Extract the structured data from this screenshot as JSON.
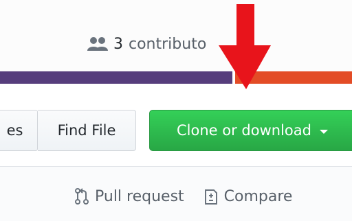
{
  "contributors": {
    "icon": "people-icon",
    "count": "3",
    "label": "contributo"
  },
  "language_bar": {
    "colors": [
      "#563d7c",
      "#e34c26"
    ]
  },
  "toolbar": {
    "prev_label": "es",
    "find_file_label": "Find File",
    "clone_label": "Clone or download",
    "clone_color": "#28a745"
  },
  "actions": {
    "pull_request_label": "Pull request",
    "compare_label": "Compare"
  },
  "annotation": {
    "type": "red-arrow",
    "color": "#e8141b"
  }
}
